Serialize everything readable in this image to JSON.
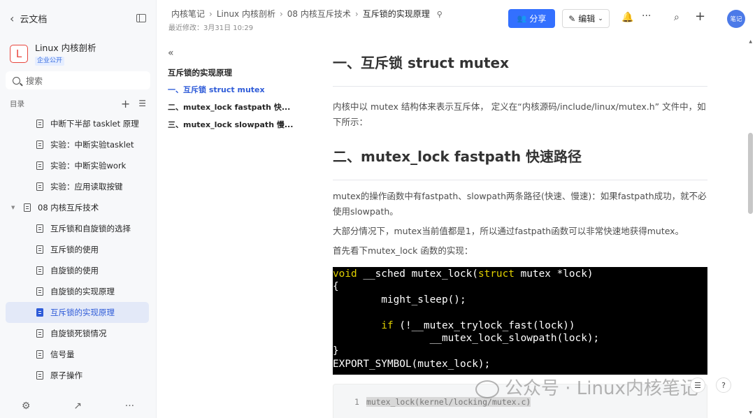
{
  "sidebar": {
    "back_label": "云文档",
    "kb_logo": "L",
    "kb_name": "Linux 内核剖析",
    "kb_badge": "企业公开",
    "search_placeholder": "搜索",
    "toc_label": "目录",
    "items": [
      {
        "label": "中断下半部 tasklet 原理",
        "level": 2
      },
      {
        "label": "实验：中断实验tasklet",
        "level": 2
      },
      {
        "label": "实验：中断实验work",
        "level": 2
      },
      {
        "label": "实验：应用读取按键",
        "level": 2
      },
      {
        "label": "08 内核互斥技术",
        "level": 1
      },
      {
        "label": "互斥锁和自旋锁的选择",
        "level": 2
      },
      {
        "label": "互斥锁的使用",
        "level": 2
      },
      {
        "label": "自旋锁的使用",
        "level": 2
      },
      {
        "label": "自旋锁的实现原理",
        "level": 2
      },
      {
        "label": "互斥锁的实现原理",
        "level": 2,
        "active": true
      },
      {
        "label": "自旋锁死锁情况",
        "level": 2
      },
      {
        "label": "信号量",
        "level": 2
      },
      {
        "label": "原子操作",
        "level": 2
      }
    ]
  },
  "header": {
    "breadcrumb": [
      "内核笔记",
      "Linux 内核剖析",
      "08 内核互斥技术",
      "互斥锁的实现原理"
    ],
    "last_modified": "最近修改：3月31日 10:29",
    "share_label": "分享",
    "edit_label": "编辑",
    "avatar_label": "笔记"
  },
  "outline": {
    "title": "互斥锁的实现原理",
    "items": [
      {
        "label": "一、互斥锁 struct mutex",
        "active": true
      },
      {
        "label": "二、mutex_lock fastpath 快..."
      },
      {
        "label": "三、mutex_lock slowpath 慢..."
      }
    ]
  },
  "content": {
    "h1_1": "一、互斥锁 struct mutex",
    "p1": "内核中以 mutex 结构体来表示互斥体， 定义在“内核源码/include/linux/mutex.h” 文件中，如下所示：",
    "h1_2": "二、mutex_lock fastpath 快速路径",
    "p2": "mutex的操作函数中有fastpath、slowpath两条路径(快速、慢速)：如果fastpath成功，就不必使用slowpath。",
    "p3": "大部分情况下，mutex当前值都是1，所以通过fastpath函数可以非常快速地获得mutex。",
    "p4": "首先看下mutex_lock 函数的实现：",
    "code_box_line": "1",
    "code_box_text": "mutex_lock(kernel/locking/mutex.c)"
  },
  "watermark": "公众号 · Linux内核笔记"
}
